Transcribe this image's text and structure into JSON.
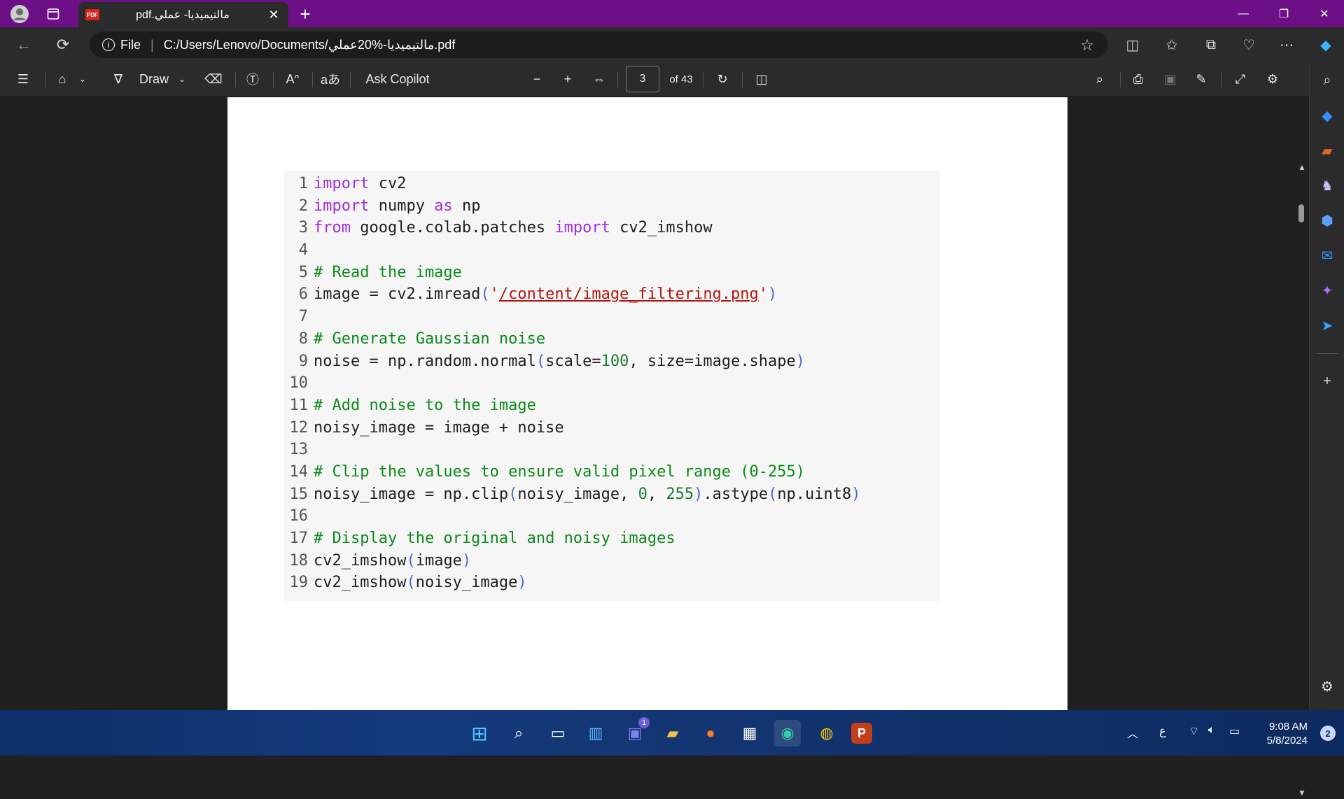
{
  "browser": {
    "tab_title": "مالتيميديا- عملي.pdf",
    "address_prefix": "File",
    "address_url": "C:/Users/Lenovo/Documents/مالتيميديا-%20عملي.pdf"
  },
  "pdf_toolbar": {
    "draw_label": "Draw",
    "ask_copilot_label": "Ask Copilot",
    "page_number": "3",
    "page_total": "of 43"
  },
  "code_lines": [
    {
      "n": "1"
    },
    {
      "n": "2"
    },
    {
      "n": "3"
    },
    {
      "n": "4"
    },
    {
      "n": "5"
    },
    {
      "n": "6"
    },
    {
      "n": "7"
    },
    {
      "n": "8"
    },
    {
      "n": "9"
    },
    {
      "n": "10"
    },
    {
      "n": "11"
    },
    {
      "n": "12"
    },
    {
      "n": "13"
    },
    {
      "n": "14"
    },
    {
      "n": "15"
    },
    {
      "n": "16"
    },
    {
      "n": "17"
    },
    {
      "n": "18"
    },
    {
      "n": "19"
    }
  ],
  "code": {
    "l1": [
      "import",
      " cv2"
    ],
    "l2": [
      "import",
      " numpy ",
      "as",
      " np"
    ],
    "l3": [
      "from",
      " google.colab.patches ",
      "import",
      " cv2_imshow"
    ],
    "l5": "# Read the image",
    "l6": [
      "image = cv2.imread",
      "(",
      "'",
      "/content/image_filtering.png",
      "'",
      ")"
    ],
    "l8": "# Generate Gaussian noise",
    "l9": [
      "noise = np.random.normal",
      "(",
      "scale=",
      "100",
      ", size=image.shape",
      ")"
    ],
    "l11": "# Add noise to the image",
    "l12": "noisy_image = image + noise",
    "l14": "# Clip the values to ensure valid pixel range (0-255)",
    "l15": [
      "noisy_image = np.clip",
      "(",
      "noisy_image, ",
      "0",
      ", ",
      "255",
      ")",
      ".astype",
      "(",
      "np.uint8",
      ")"
    ],
    "l17": "# Display the original and noisy images",
    "l18": [
      "cv2_imshow",
      "(",
      "image",
      ")"
    ],
    "l19": [
      "cv2_imshow",
      "(",
      "noisy_image",
      ")"
    ]
  },
  "taskbar": {
    "time": "9:08 AM",
    "date": "5/8/2024",
    "lang": "ع",
    "notif_count": "2",
    "teams_badge": "1"
  },
  "colors": {
    "titlebar": "#6d0f86",
    "keyword": "#a22ed8",
    "comment": "#0b8a1a",
    "string": "#b3160f"
  }
}
